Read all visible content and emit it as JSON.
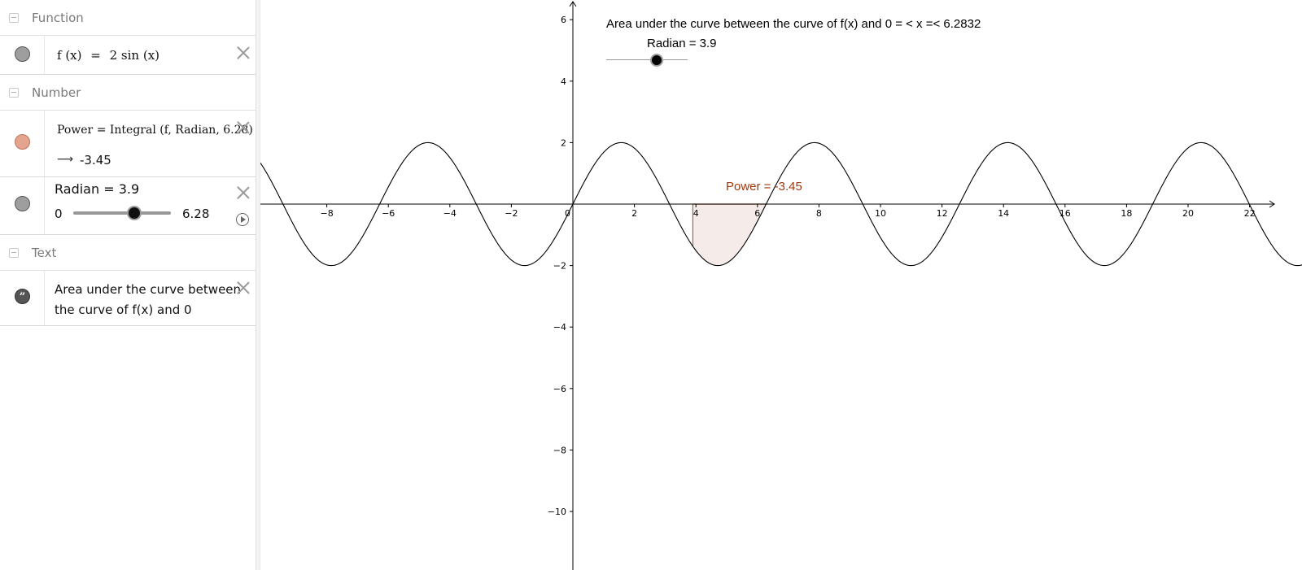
{
  "algebra": {
    "groups": [
      {
        "label": "Function"
      },
      {
        "label": "Number"
      },
      {
        "label": "Text"
      }
    ],
    "function_item": {
      "lhs": "f (x)",
      "eq": "=",
      "rhs": "2  sin (x)"
    },
    "power_item": {
      "definition": "Power = Integral (f, Radian, 6.28)",
      "arrow": "⟶",
      "value": "-3.45"
    },
    "radian_item": {
      "label": "Radian = 3.9",
      "min": "0",
      "max": "6.28",
      "value": 3.9,
      "min_value": 0,
      "max_value": 6.28
    },
    "text_item": {
      "line1": "Area under the curve between",
      "line2": "the curve of f(x) and 0"
    }
  },
  "graphics": {
    "caption": "Area under the curve between the curve of f(x) and  0 = <  x  =< 6.2832",
    "slider_label": "Radian = 3.9",
    "power_label": "Power = -3.45",
    "colors": {
      "area_fill": "#f5ebe8",
      "area_stroke": "#c55a2e",
      "power_label": "#a0390e",
      "curve": "#000000"
    }
  },
  "chart_data": {
    "type": "line",
    "function": "f(x) = 2 sin(x)",
    "amplitude": 2,
    "xlim": [
      -9.6,
      23.0
    ],
    "ylim": [
      -11.4,
      6.5
    ],
    "x_ticks": [
      -8,
      -6,
      -4,
      -2,
      0,
      2,
      4,
      6,
      8,
      10,
      12,
      14,
      16,
      18,
      20,
      22
    ],
    "y_ticks": [
      6,
      4,
      2,
      -2,
      -4,
      -6,
      -8,
      -10
    ],
    "x_tick_labels": [
      "−8",
      "−6",
      "−4",
      "−2",
      "0",
      "2",
      "4",
      "6",
      "8",
      "10",
      "12",
      "14",
      "16",
      "18",
      "20",
      "22"
    ],
    "y_tick_labels": [
      "6",
      "4",
      "2",
      "−2",
      "−4",
      "−6",
      "−8",
      "−10"
    ],
    "shaded_area": {
      "from": 3.9,
      "to": 6.28,
      "integral": -3.45
    }
  }
}
